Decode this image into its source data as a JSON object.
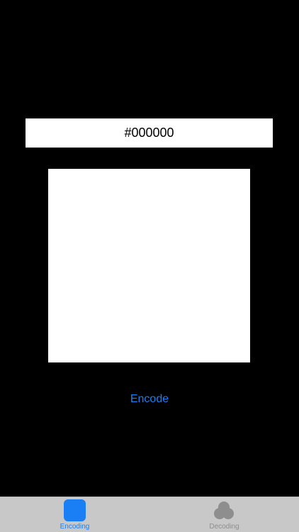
{
  "color_input": {
    "value": "#000000"
  },
  "preview": {
    "color": "#ffffff"
  },
  "actions": {
    "encode_label": "Encode",
    "accent_color": "#1a7ff5"
  },
  "tab_bar": {
    "tabs": [
      {
        "label": "Encoding",
        "icon": "square-icon",
        "selected": true,
        "color": "#1a7ff5"
      },
      {
        "label": "Decoding",
        "icon": "overlapping-circles-icon",
        "selected": false,
        "color": "#8e8e8e"
      }
    ]
  }
}
